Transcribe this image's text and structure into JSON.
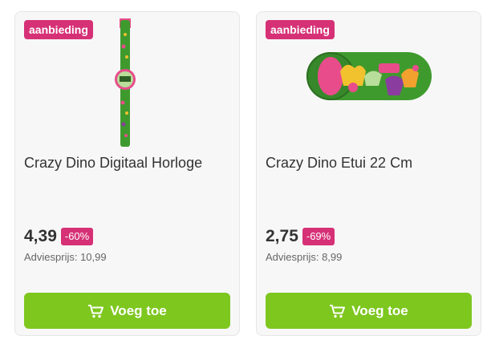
{
  "products": [
    {
      "badge": "aanbieding",
      "title": "Crazy Dino Digitaal Horloge",
      "price": "4,39",
      "discount": "-60%",
      "advies": "Adviesprijs: 10,99",
      "button_label": "Voeg toe",
      "image_icon": "watch-image"
    },
    {
      "badge": "aanbieding",
      "title": "Crazy Dino Etui 22 Cm",
      "price": "2,75",
      "discount": "-69%",
      "advies": "Adviesprijs: 8,99",
      "button_label": "Voeg toe",
      "image_icon": "pencil-case-image"
    }
  ],
  "colors": {
    "badge": "#d63176",
    "button": "#7ec71f",
    "card_bg": "#f7f7f7"
  }
}
